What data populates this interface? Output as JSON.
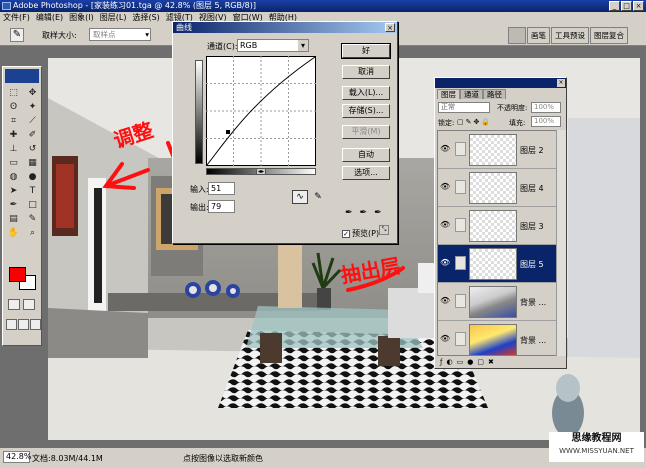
{
  "app": {
    "title": "Adobe Photoshop - [家装练习01.tga @ 42.8% (图层 5, RGB/8)]"
  },
  "menu": [
    "文件(F)",
    "编辑(E)",
    "图象(I)",
    "图层(L)",
    "选择(S)",
    "滤镜(T)",
    "视图(V)",
    "窗口(W)",
    "帮助(H)"
  ],
  "options": {
    "sample_label": "取样大小:",
    "sample_value": "取样点"
  },
  "palette_well": [
    "画笔",
    "工具预设",
    "图层复合"
  ],
  "curves": {
    "title": "曲线",
    "channel_label": "通道(C):",
    "channel_value": "RGB",
    "input_label": "输入:",
    "input_value": "51",
    "output_label": "输出:",
    "output_value": "79",
    "buttons": [
      "好",
      "取消",
      "载入(L)...",
      "存储(S)...",
      "平滑(M)",
      "自动",
      "选项..."
    ],
    "preview_label": "预览(P)"
  },
  "layers_panel": {
    "tabs": [
      "图层",
      "通道",
      "路径"
    ],
    "blend_mode": "正常",
    "opacity_label": "不透明度:",
    "opacity_value": "100%",
    "lock_label": "锁定:",
    "fill_label": "填充:",
    "fill_value": "100%",
    "layers": [
      {
        "name": "图层 2",
        "selected": false
      },
      {
        "name": "图层 4",
        "selected": false
      },
      {
        "name": "图层 3",
        "selected": false
      },
      {
        "name": "图层 5",
        "selected": true
      },
      {
        "name": "背景 ...",
        "selected": false
      },
      {
        "name": "背景 ...",
        "selected": false
      }
    ]
  },
  "annotations": {
    "top": "调整",
    "bottom": "抽出层"
  },
  "status": {
    "zoom": "42.8%",
    "doc_info": "文档:8.03M/44.1M",
    "hint": "点按图像以选取新颜色"
  },
  "watermark": {
    "line1": "思缘教程网",
    "line2": "WWW.MISSYUAN.NET"
  }
}
